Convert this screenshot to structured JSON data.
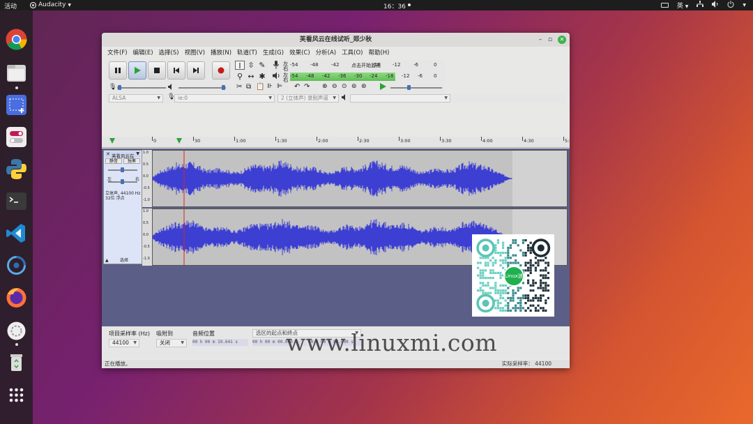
{
  "topbar": {
    "activities": "活动",
    "app_name": "Audacity",
    "clock": "16：36",
    "input_method": "英"
  },
  "window": {
    "title": "芙看风云在线试听_郑少秋",
    "menu": [
      "文件(F)",
      "编辑(E)",
      "选择(S)",
      "视图(V)",
      "播放(N)",
      "轨道(T)",
      "生成(G)",
      "效果(C)",
      "分析(A)",
      "工具(O)",
      "帮助(H)"
    ]
  },
  "meters": {
    "rec_labels": [
      "左",
      "右"
    ],
    "play_labels": [
      "左",
      "右"
    ],
    "rec_scale": [
      "-54",
      "-48",
      "-42",
      "点击开始监视",
      "-18",
      "-12",
      "-6",
      "0"
    ],
    "play_scale": [
      "-54",
      "-48",
      "-42",
      "-36",
      "-30",
      "-24",
      "-18",
      "-12",
      "-6",
      "0"
    ],
    "play_level": 0.68
  },
  "device_bar": {
    "host": "ALSA",
    "rec_device": "ie:0",
    "channels": "2 (立体声) 录制声道"
  },
  "ruler": {
    "ticks": [
      "0",
      "30",
      "1:00",
      "1:30",
      "2:00",
      "2:30",
      "3:00",
      "3:30",
      "4:00",
      "4:30",
      "5:00"
    ]
  },
  "track": {
    "name": "芙看风云在",
    "mute": "静音",
    "solo": "独奏",
    "pan_left": "左",
    "pan_right": "右",
    "info": "立体声, 44100 Hz",
    "info2": "32位 浮点",
    "select": "选择",
    "db_scale": [
      "1.0",
      "0.5",
      "0.0",
      "-0.5",
      "-1.0"
    ]
  },
  "selection_bar": {
    "rate_label": "项目采样率 (Hz)",
    "rate_value": "44100",
    "snap_label": "吸附到",
    "snap_value": "关闭",
    "pos_label": "音频位置",
    "pos_value": "00 h 00 m 19.641 s",
    "range_label": "选区的起点和终点",
    "range_start": "00 h 00 m 00.000 s",
    "range_end": "00 h 00 m 00.000 s"
  },
  "status": {
    "left": "正在播放。",
    "right": "实际采样率： 44100"
  },
  "qr": {
    "center_label": "Linux迷"
  },
  "watermark": "www.linuxmi.com",
  "colors": {
    "waveform": "#3c3fd2",
    "track_bg": "#5b5f87",
    "meter_green": "#47b63a",
    "playhead": "#e02020"
  }
}
